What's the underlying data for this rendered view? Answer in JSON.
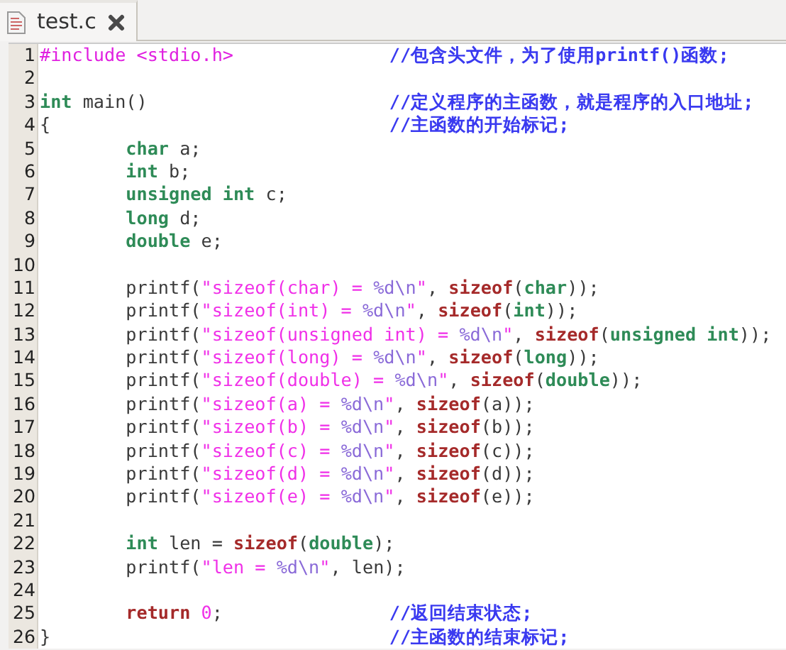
{
  "tabs": [
    {
      "label": "test.c",
      "selected": true
    }
  ],
  "lines": [
    {
      "number": "1",
      "indented": false,
      "code": [
        {
          "kind": "directive",
          "text": "#include <stdio.h>"
        }
      ],
      "comment": "//包含头文件，为了使用printf()函数;"
    },
    {
      "number": "2"
    },
    {
      "number": "3",
      "indented": false,
      "code": [
        {
          "kind": "type",
          "text": "int"
        },
        {
          "kind": "plain",
          "text": " main()"
        }
      ],
      "comment": "//定义程序的主函数，就是程序的入口地址;"
    },
    {
      "number": "4",
      "indented": false,
      "code": [
        {
          "kind": "plain",
          "text": "{"
        }
      ],
      "comment": "//主函数的开始标记;"
    },
    {
      "number": "5",
      "indented": true,
      "code": [
        {
          "kind": "type",
          "text": "char"
        },
        {
          "kind": "plain",
          "text": " a;"
        }
      ]
    },
    {
      "number": "6",
      "indented": true,
      "code": [
        {
          "kind": "type",
          "text": "int"
        },
        {
          "kind": "plain",
          "text": " b;"
        }
      ]
    },
    {
      "number": "7",
      "indented": true,
      "code": [
        {
          "kind": "type",
          "text": "unsigned int"
        },
        {
          "kind": "plain",
          "text": " c;"
        }
      ]
    },
    {
      "number": "8",
      "indented": true,
      "code": [
        {
          "kind": "type",
          "text": "long"
        },
        {
          "kind": "plain",
          "text": " d;"
        }
      ]
    },
    {
      "number": "9",
      "indented": true,
      "code": [
        {
          "kind": "type",
          "text": "double"
        },
        {
          "kind": "plain",
          "text": " e;"
        }
      ]
    },
    {
      "number": "10"
    },
    {
      "number": "11",
      "indented": true,
      "code": [
        {
          "kind": "plain",
          "text": "printf("
        },
        {
          "kind": "string",
          "text": "\"sizeof(char) = "
        },
        {
          "kind": "format",
          "text": "%d\\n"
        },
        {
          "kind": "string",
          "text": "\""
        },
        {
          "kind": "plain",
          "text": ", "
        },
        {
          "kind": "builtin",
          "text": "sizeof"
        },
        {
          "kind": "plain",
          "text": "("
        },
        {
          "kind": "type",
          "text": "char"
        },
        {
          "kind": "plain",
          "text": "));"
        }
      ]
    },
    {
      "number": "12",
      "indented": true,
      "code": [
        {
          "kind": "plain",
          "text": "printf("
        },
        {
          "kind": "string",
          "text": "\"sizeof(int) = "
        },
        {
          "kind": "format",
          "text": "%d\\n"
        },
        {
          "kind": "string",
          "text": "\""
        },
        {
          "kind": "plain",
          "text": ", "
        },
        {
          "kind": "builtin",
          "text": "sizeof"
        },
        {
          "kind": "plain",
          "text": "("
        },
        {
          "kind": "type",
          "text": "int"
        },
        {
          "kind": "plain",
          "text": "));"
        }
      ]
    },
    {
      "number": "13",
      "indented": true,
      "code": [
        {
          "kind": "plain",
          "text": "printf("
        },
        {
          "kind": "string",
          "text": "\"sizeof(unsigned int) = "
        },
        {
          "kind": "format",
          "text": "%d\\n"
        },
        {
          "kind": "string",
          "text": "\""
        },
        {
          "kind": "plain",
          "text": ", "
        },
        {
          "kind": "builtin",
          "text": "sizeof"
        },
        {
          "kind": "plain",
          "text": "("
        },
        {
          "kind": "type",
          "text": "unsigned int"
        },
        {
          "kind": "plain",
          "text": "));"
        }
      ]
    },
    {
      "number": "14",
      "indented": true,
      "code": [
        {
          "kind": "plain",
          "text": "printf("
        },
        {
          "kind": "string",
          "text": "\"sizeof(long) = "
        },
        {
          "kind": "format",
          "text": "%d\\n"
        },
        {
          "kind": "string",
          "text": "\""
        },
        {
          "kind": "plain",
          "text": ", "
        },
        {
          "kind": "builtin",
          "text": "sizeof"
        },
        {
          "kind": "plain",
          "text": "("
        },
        {
          "kind": "type",
          "text": "long"
        },
        {
          "kind": "plain",
          "text": "));"
        }
      ]
    },
    {
      "number": "15",
      "indented": true,
      "code": [
        {
          "kind": "plain",
          "text": "printf("
        },
        {
          "kind": "string",
          "text": "\"sizeof(double) = "
        },
        {
          "kind": "format",
          "text": "%d\\n"
        },
        {
          "kind": "string",
          "text": "\""
        },
        {
          "kind": "plain",
          "text": ", "
        },
        {
          "kind": "builtin",
          "text": "sizeof"
        },
        {
          "kind": "plain",
          "text": "("
        },
        {
          "kind": "type",
          "text": "double"
        },
        {
          "kind": "plain",
          "text": "));"
        }
      ]
    },
    {
      "number": "16",
      "indented": true,
      "code": [
        {
          "kind": "plain",
          "text": "printf("
        },
        {
          "kind": "string",
          "text": "\"sizeof(a) = "
        },
        {
          "kind": "format",
          "text": "%d\\n"
        },
        {
          "kind": "string",
          "text": "\""
        },
        {
          "kind": "plain",
          "text": ", "
        },
        {
          "kind": "builtin",
          "text": "sizeof"
        },
        {
          "kind": "plain",
          "text": "(a));"
        }
      ]
    },
    {
      "number": "17",
      "indented": true,
      "code": [
        {
          "kind": "plain",
          "text": "printf("
        },
        {
          "kind": "string",
          "text": "\"sizeof(b) = "
        },
        {
          "kind": "format",
          "text": "%d\\n"
        },
        {
          "kind": "string",
          "text": "\""
        },
        {
          "kind": "plain",
          "text": ", "
        },
        {
          "kind": "builtin",
          "text": "sizeof"
        },
        {
          "kind": "plain",
          "text": "(b));"
        }
      ]
    },
    {
      "number": "18",
      "indented": true,
      "code": [
        {
          "kind": "plain",
          "text": "printf("
        },
        {
          "kind": "string",
          "text": "\"sizeof(c) = "
        },
        {
          "kind": "format",
          "text": "%d\\n"
        },
        {
          "kind": "string",
          "text": "\""
        },
        {
          "kind": "plain",
          "text": ", "
        },
        {
          "kind": "builtin",
          "text": "sizeof"
        },
        {
          "kind": "plain",
          "text": "(c));"
        }
      ]
    },
    {
      "number": "19",
      "indented": true,
      "code": [
        {
          "kind": "plain",
          "text": "printf("
        },
        {
          "kind": "string",
          "text": "\"sizeof(d) = "
        },
        {
          "kind": "format",
          "text": "%d\\n"
        },
        {
          "kind": "string",
          "text": "\""
        },
        {
          "kind": "plain",
          "text": ", "
        },
        {
          "kind": "builtin",
          "text": "sizeof"
        },
        {
          "kind": "plain",
          "text": "(d));"
        }
      ]
    },
    {
      "number": "20",
      "indented": true,
      "code": [
        {
          "kind": "plain",
          "text": "printf("
        },
        {
          "kind": "string",
          "text": "\"sizeof(e) = "
        },
        {
          "kind": "format",
          "text": "%d\\n"
        },
        {
          "kind": "string",
          "text": "\""
        },
        {
          "kind": "plain",
          "text": ", "
        },
        {
          "kind": "builtin",
          "text": "sizeof"
        },
        {
          "kind": "plain",
          "text": "(e));"
        }
      ]
    },
    {
      "number": "21"
    },
    {
      "number": "22",
      "indented": true,
      "code": [
        {
          "kind": "type",
          "text": "int"
        },
        {
          "kind": "plain",
          "text": " len = "
        },
        {
          "kind": "builtin",
          "text": "sizeof"
        },
        {
          "kind": "plain",
          "text": "("
        },
        {
          "kind": "type",
          "text": "double"
        },
        {
          "kind": "plain",
          "text": ");"
        }
      ]
    },
    {
      "number": "23",
      "indented": true,
      "code": [
        {
          "kind": "plain",
          "text": "printf("
        },
        {
          "kind": "string",
          "text": "\"len = "
        },
        {
          "kind": "format",
          "text": "%d\\n"
        },
        {
          "kind": "string",
          "text": "\""
        },
        {
          "kind": "plain",
          "text": ", len);"
        }
      ]
    },
    {
      "number": "24"
    },
    {
      "number": "25",
      "indented": true,
      "code": [
        {
          "kind": "builtin",
          "text": "return"
        },
        {
          "kind": "number",
          "text": "0"
        },
        {
          "kind": "plain",
          "text": ";"
        }
      ],
      "comment": "//返回结束状态;"
    },
    {
      "number": "26",
      "indented": false,
      "code": [
        {
          "kind": "plain",
          "text": "}"
        }
      ],
      "comment": "//主函数的结束标记;"
    }
  ]
}
